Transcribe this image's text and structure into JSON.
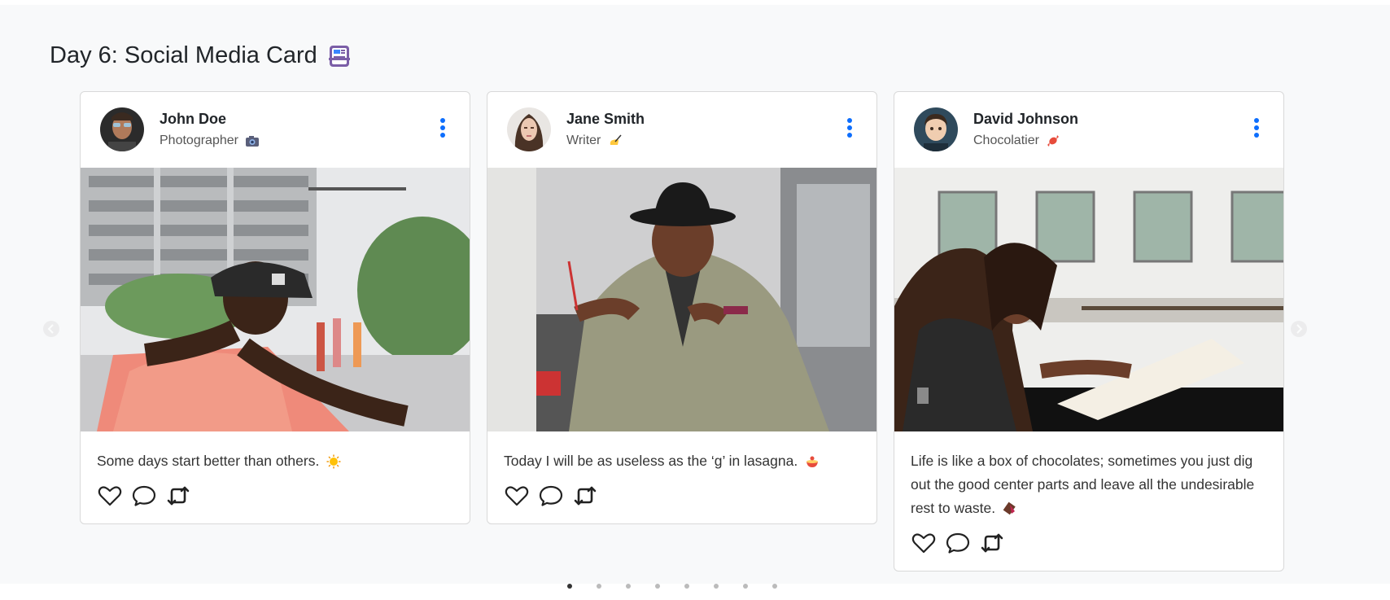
{
  "page": {
    "title": "Day 6: Social Media Card"
  },
  "cards": [
    {
      "name": "John Doe",
      "role": "Photographer",
      "caption": "Some days start better than others."
    },
    {
      "name": "Jane Smith",
      "role": "Writer",
      "caption": "Today I will be as useless as the ‘g’ in lasagna."
    },
    {
      "name": "David Johnson",
      "role": "Chocolatier",
      "caption": "Life is like a box of chocolates; sometimes you just dig out the good center parts and leave all the undesirable rest to waste."
    }
  ],
  "carousel": {
    "slide_count": 8,
    "active_index": 0
  },
  "colors": {
    "accent": "#0d6efd",
    "background": "#f8f9fa"
  }
}
